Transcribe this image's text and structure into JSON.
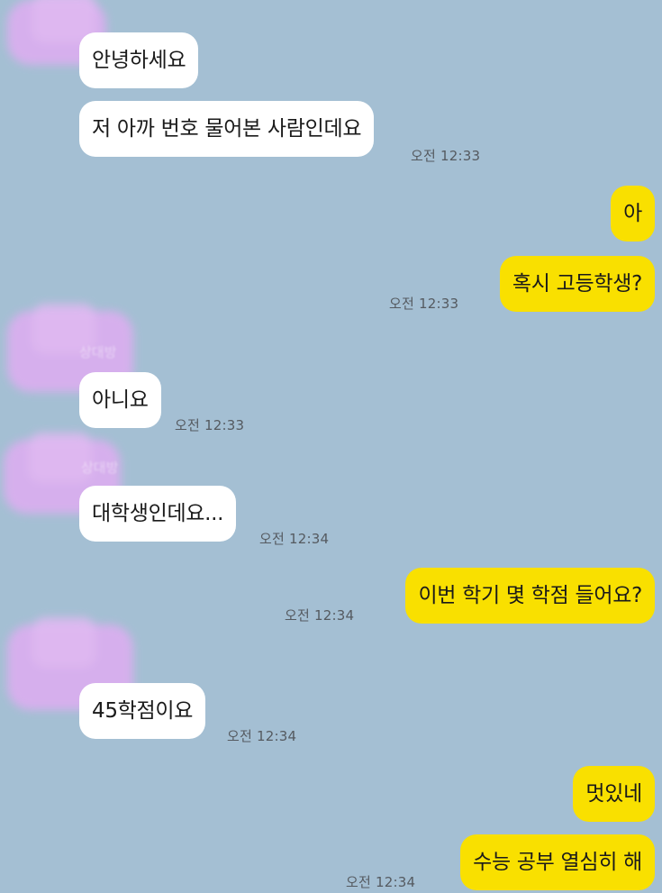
{
  "messages": [
    {
      "from": "other",
      "text": "안녕하세요"
    },
    {
      "from": "other",
      "text": "저 아까 번호 물어본 사람인데요",
      "time": "오전 12:33"
    },
    {
      "from": "me",
      "text": "아"
    },
    {
      "from": "me",
      "text": "혹시 고등학생?",
      "time": "오전 12:33"
    },
    {
      "from": "other",
      "text": "아니요",
      "time": "오전 12:33"
    },
    {
      "from": "other",
      "text": "대학생인데요...",
      "time": "오전 12:34"
    },
    {
      "from": "me",
      "text": "이번 학기 몇 학점 들어요?",
      "time": "오전 12:34"
    },
    {
      "from": "other",
      "text": "45학점이요",
      "time": "오전 12:34"
    },
    {
      "from": "me",
      "text": "멋있네"
    },
    {
      "from": "me",
      "text": "수능 공부 열심히 해",
      "time": "오전 12:34"
    }
  ],
  "sender_names": [
    "상대방",
    "상대방"
  ],
  "colors": {
    "background": "#a4bfd3",
    "incoming_bubble": "#ffffff",
    "outgoing_bubble": "#f9e000",
    "avatar_blur": "#dcaef0"
  }
}
